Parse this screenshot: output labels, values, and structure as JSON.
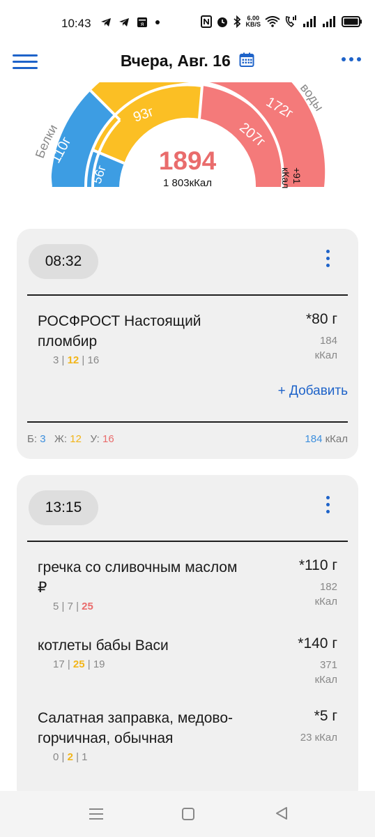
{
  "status_bar": {
    "time": "10:43",
    "net_speed_value": "6.00",
    "net_speed_unit": "KB/S"
  },
  "header": {
    "title": "Вчера, Авг. 16",
    "accent_color": "#1e63c9"
  },
  "summary": {
    "kcal_total": "1894",
    "kcal_target": "1 803кКал",
    "kcal_over": "+91 кКал",
    "protein_label": "Белки",
    "carbs_label": "воды",
    "protein_goal": "110г",
    "protein_value": "56г",
    "fat_value": "93г",
    "carbs_goal": "172г",
    "carbs_value": "207г",
    "colors": {
      "protein": "#3d9de3",
      "fat": "#fbbf24",
      "carbs": "#f47a7a"
    }
  },
  "meals": [
    {
      "time": "08:32",
      "items": [
        {
          "name": "РОСФРОСТ Настоящий пломбир",
          "qty": "*80 г",
          "kcal_num": "184",
          "kcal_unit": "кКал",
          "p": "3",
          "f": "12",
          "c": "16"
        }
      ],
      "add_label": "+ Добавить",
      "totals": {
        "p_label": "Б:",
        "p": "3",
        "f_label": "Ж:",
        "f": "12",
        "c_label": "У:",
        "c": "16",
        "kcal": "184",
        "kcal_unit": "кКал"
      }
    },
    {
      "time": "13:15",
      "items": [
        {
          "name": "гречка со сливочным маслом ₽",
          "qty": "*110 г",
          "kcal_num": "182",
          "kcal_unit": "кКал",
          "p": "5",
          "f": "7",
          "c": "25"
        },
        {
          "name": "котлеты бабы Васи",
          "qty": "*140 г",
          "kcal_num": "371",
          "kcal_unit": "кКал",
          "p": "17",
          "f": "25",
          "c": "19"
        },
        {
          "name": "Салатная заправка, медово-горчичная, обычная",
          "qty": "*5 г",
          "kcal_num": "23",
          "kcal_unit": "кКал",
          "p": "0",
          "f": "2",
          "c": "1"
        }
      ]
    }
  ]
}
